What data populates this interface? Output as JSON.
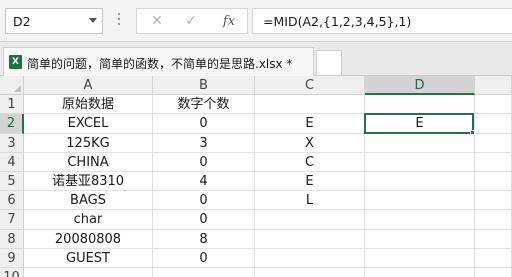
{
  "name_box": {
    "value": "D2"
  },
  "formula_bar": {
    "cancel_icon": "✕",
    "enter_icon": "✓",
    "function_icon": "fx",
    "formula": "=MID(A2,{1,2,3,4,5},1)"
  },
  "document_tab": {
    "icon": "X",
    "title": "简单的问题，简单的函数，不简单的是思路.xlsx *"
  },
  "sheet": {
    "columns": [
      "A",
      "B",
      "C",
      "D"
    ],
    "active_column": "D",
    "active_row": "2",
    "rows": [
      {
        "num": "1",
        "cells": [
          "原始数据",
          "数字个数",
          "",
          ""
        ]
      },
      {
        "num": "2",
        "cells": [
          "EXCEL",
          "0",
          "E",
          "E"
        ]
      },
      {
        "num": "3",
        "cells": [
          "125KG",
          "3",
          "X",
          ""
        ]
      },
      {
        "num": "4",
        "cells": [
          "CHINA",
          "0",
          "C",
          ""
        ]
      },
      {
        "num": "5",
        "cells": [
          "诺基亚8310",
          "4",
          "E",
          ""
        ]
      },
      {
        "num": "6",
        "cells": [
          "BAGS",
          "0",
          "L",
          ""
        ]
      },
      {
        "num": "7",
        "cells": [
          "char",
          "0",
          "",
          ""
        ]
      },
      {
        "num": "8",
        "cells": [
          "20080808",
          "8",
          "",
          ""
        ]
      },
      {
        "num": "9",
        "cells": [
          "GUEST",
          "0",
          "",
          ""
        ]
      },
      {
        "num": "10",
        "cells": [
          "",
          "",
          "",
          ""
        ]
      }
    ]
  },
  "colors": {
    "accent": "#217346",
    "excel_icon": "#1e7145"
  }
}
